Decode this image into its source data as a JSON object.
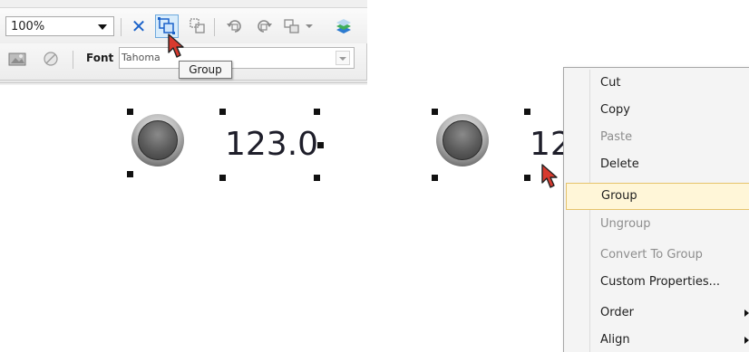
{
  "toolbar": {
    "zoom_value": "100%",
    "font_label": "Font",
    "font_value": "Tahoma",
    "tooltip": "Group"
  },
  "canvas": {
    "readout_left": "123.0",
    "readout_right": "12"
  },
  "context_menu": {
    "items": [
      {
        "label": "Cut",
        "enabled": true
      },
      {
        "label": "Copy",
        "enabled": true
      },
      {
        "label": "Paste",
        "enabled": false
      },
      {
        "label": "Delete",
        "enabled": true
      },
      {
        "label": "Group",
        "enabled": true,
        "highlighted": true
      },
      {
        "label": "Ungroup",
        "enabled": false
      },
      {
        "label": "Convert To Group",
        "enabled": false
      },
      {
        "label": "Custom Properties...",
        "enabled": true
      },
      {
        "label": "Order",
        "enabled": true,
        "submenu": true
      },
      {
        "label": "Align",
        "enabled": true,
        "submenu": true
      }
    ]
  },
  "colors": {
    "highlight": "#fff6d8",
    "accent_blue": "#1b62c9",
    "cursor_red": "#d83a2e"
  },
  "icons": [
    "delete-icon",
    "group-icon",
    "ungroup-icon",
    "rotate-left-icon",
    "rotate-right-icon",
    "order-icon",
    "layer-icon",
    "image-icon",
    "disabled-icon",
    "mouse-pointer-icon"
  ]
}
